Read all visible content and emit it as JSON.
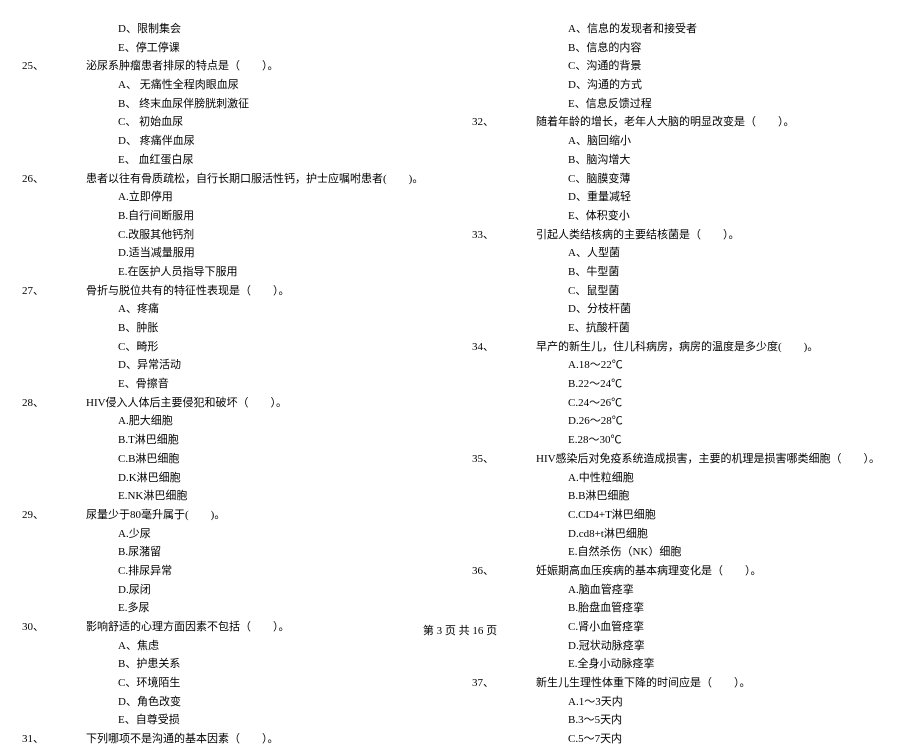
{
  "col1": {
    "pre_options": [
      "D、限制集会",
      "E、停工停课"
    ],
    "questions": [
      {
        "num": "25、",
        "text": "泌尿系肿瘤患者排尿的特点是（　　）。",
        "options": [
          "A、 无痛性全程肉眼血尿",
          "B、 终末血尿伴膀胱刺激征",
          "C、 初始血尿",
          "D、 疼痛伴血尿",
          "E、 血红蛋白尿"
        ]
      },
      {
        "num": "26、",
        "text": "患者以往有骨质疏松，自行长期口服活性钙，护士应嘱咐患者(　　)。",
        "options": [
          "A.立即停用",
          "B.自行间断服用",
          "C.改服其他钙剂",
          "D.适当减量服用",
          "E.在医护人员指导下服用"
        ]
      },
      {
        "num": "27、",
        "text": "骨折与脱位共有的特征性表现是（　　）。",
        "options": [
          "A、疼痛",
          "B、肿胀",
          "C、畸形",
          "D、异常活动",
          "E、骨擦音"
        ]
      },
      {
        "num": "28、",
        "text": "HIV侵入人体后主要侵犯和破坏（　　）。",
        "options": [
          "A.肥大细胞",
          "B.T淋巴细胞",
          "C.B淋巴细胞",
          "D.K淋巴细胞",
          "E.NK淋巴细胞"
        ]
      },
      {
        "num": "29、",
        "text": "尿量少于80毫升属于(　　)。",
        "options": [
          "A.少尿",
          "B.尿潴留",
          "C.排尿异常",
          "D.尿闭",
          "E.多尿"
        ]
      },
      {
        "num": "30、",
        "text": "影响舒适的心理方面因素不包括（　　）。",
        "options": [
          "A、焦虑",
          "B、护患关系",
          "C、环境陌生",
          "D、角色改变",
          "E、自尊受损"
        ]
      },
      {
        "num": "31、",
        "text": "下列哪项不是沟通的基本因素（　　）。",
        "options": []
      }
    ]
  },
  "col2": {
    "pre_options": [
      "A、信息的发现者和接受者",
      "B、信息的内容",
      "C、沟通的背景",
      "D、沟通的方式",
      "E、信息反馈过程"
    ],
    "questions": [
      {
        "num": "32、",
        "text": "随着年龄的增长，老年人大脑的明显改变是（　　）。",
        "options": [
          "A、脑回缩小",
          "B、脑沟增大",
          "C、脑膜变薄",
          "D、重量减轻",
          "E、体积变小"
        ]
      },
      {
        "num": "33、",
        "text": "引起人类结核病的主要结核菌是（　　）。",
        "options": [
          "A、人型菌",
          "B、牛型菌",
          "C、鼠型菌",
          "D、分枝杆菌",
          "E、抗酸杆菌"
        ]
      },
      {
        "num": "34、",
        "text": "早产的新生儿，住儿科病房，病房的温度是多少度(　　)。",
        "options": [
          "A.18～22℃",
          "B.22～24℃",
          "C.24～26℃",
          "D.26～28℃",
          "E.28～30℃"
        ]
      },
      {
        "num": "35、",
        "text": "HIV感染后对免疫系统造成损害，主要的机理是损害哪类细胞（　　）。",
        "options": [
          "A.中性粒细胞",
          "B.B淋巴细胞",
          "C.CD4+T淋巴细胞",
          "D.cd8+t淋巴细胞",
          "E.自然杀伤（NK）细胞"
        ]
      },
      {
        "num": "36、",
        "text": "妊娠期高血压疾病的基本病理变化是（　　）。",
        "options": [
          "A.脑血管痉挛",
          "B.胎盘血管痉挛",
          "C.肾小血管痉挛",
          "D.冠状动脉痉挛",
          "E.全身小动脉痉挛"
        ]
      },
      {
        "num": "37、",
        "text": "新生儿生理性体重下降的时间应是（　　）。",
        "options": [
          "A.1～3天内",
          "B.3～5天内",
          "C.5～7天内"
        ]
      }
    ]
  },
  "footer": "第 3 页 共 16 页"
}
